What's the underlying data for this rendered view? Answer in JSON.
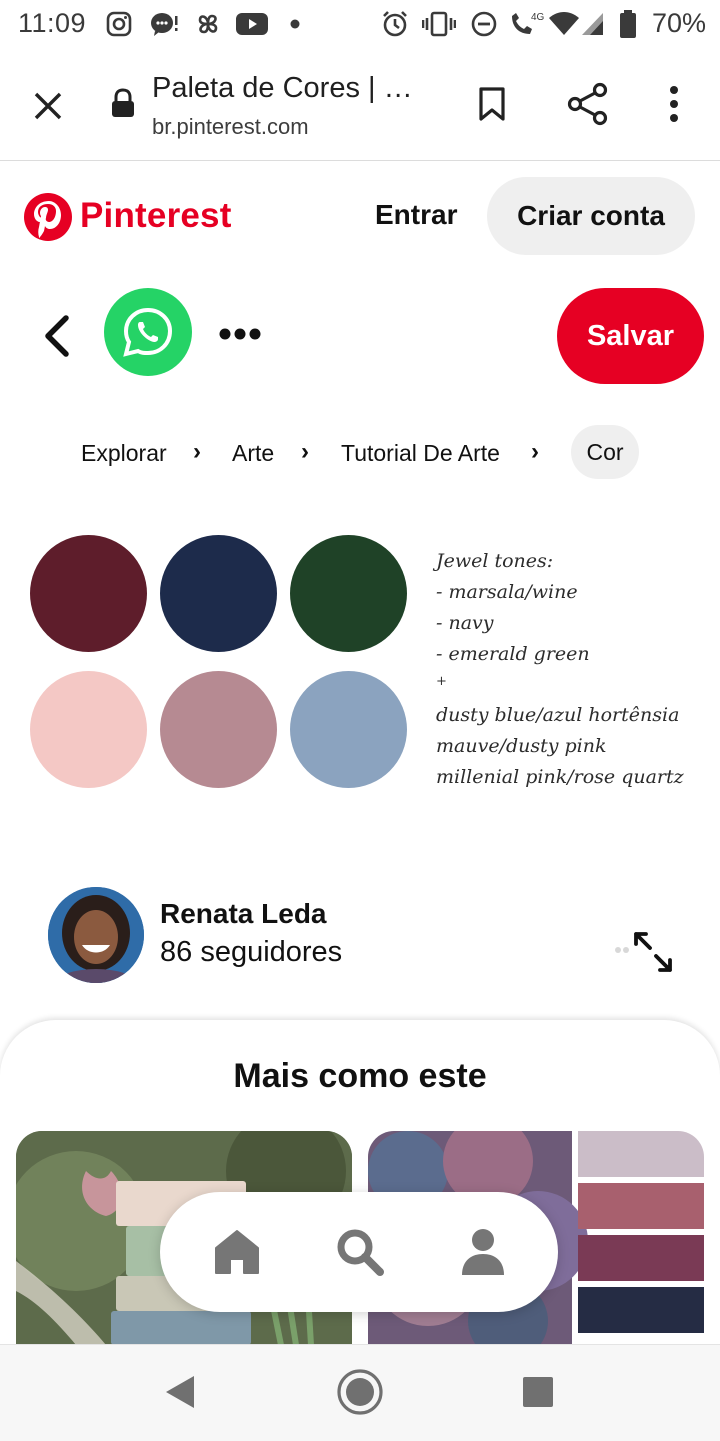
{
  "status_bar": {
    "time": "11:09",
    "network": "4G",
    "battery": "70%",
    "icons": [
      "instagram-icon",
      "messenger-icon",
      "pinwheel-icon",
      "youtube-icon",
      "dot-icon",
      "alarm-icon",
      "vibrate-icon",
      "dnd-icon",
      "wifi-call-icon",
      "wifi-icon",
      "signal-icon",
      "battery-icon"
    ]
  },
  "browser": {
    "title": "Paleta de Cores | …",
    "url": "br.pinterest.com"
  },
  "pinterest_header": {
    "brand": "Pinterest",
    "login": "Entrar",
    "signup": "Criar conta",
    "brand_color": "#e60023"
  },
  "actions": {
    "save": "Salvar"
  },
  "breadcrumb": {
    "items": [
      "Explorar",
      "Arte",
      "Tutorial De Arte"
    ],
    "current": "Cor",
    "separator": "›"
  },
  "palette": {
    "swatches": [
      "#5e1d2b",
      "#1d2b4b",
      "#1f4227",
      "#f4c8c5",
      "#b68a92",
      "#8ba3bf"
    ],
    "note_lines": [
      "Jewel tones:",
      "- marsala/wine",
      "- navy",
      "- emerald green",
      "+",
      "dusty blue/azul hortênsia",
      "mauve/dusty pink",
      "millenial pink/rose quartz"
    ]
  },
  "creator": {
    "name": "Renata Leda",
    "followers": "86 seguidores"
  },
  "more": {
    "title": "Mais como este",
    "right_palette": [
      "#cbbdc8",
      "#a8606e",
      "#7a3a55",
      "#252c44"
    ]
  }
}
